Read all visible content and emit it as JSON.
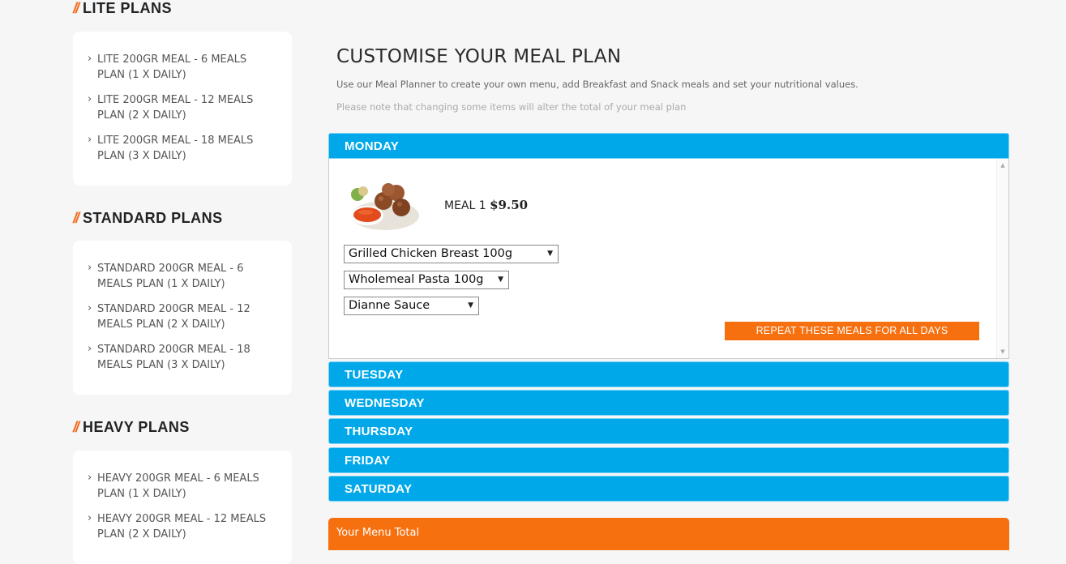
{
  "sidebar": {
    "sections": [
      {
        "slashes": "//",
        "title": "LITE PLANS",
        "items": [
          "LITE 200GR MEAL - 6 MEALS PLAN (1 X DAILY)",
          "LITE 200GR MEAL - 12 MEALS PLAN (2 X DAILY)",
          "LITE 200GR MEAL - 18 MEALS PLAN (3 X DAILY)"
        ]
      },
      {
        "slashes": "//",
        "title": "STANDARD PLANS",
        "items": [
          "STANDARD 200GR MEAL - 6 MEALS PLAN (1 X DAILY)",
          "STANDARD 200GR MEAL - 12 MEALS PLAN (2 X DAILY)",
          "STANDARD 200GR MEAL - 18 MEALS PLAN (3 X DAILY)"
        ]
      },
      {
        "slashes": "//",
        "title": "HEAVY PLANS",
        "items": [
          "HEAVY 200GR MEAL - 6 MEALS PLAN (1 X DAILY)",
          "HEAVY 200GR MEAL - 12 MEALS PLAN (2 X DAILY)"
        ]
      }
    ],
    "chevron": "›"
  },
  "main": {
    "title": "CUSTOMISE YOUR MEAL PLAN",
    "description": "Use our Meal Planner to create your own menu, add Breakfast and Snack meals and set your nutritional values.",
    "note": "Please note that changing some items will alter the total of your meal plan",
    "days": [
      "MONDAY",
      "TUESDAY",
      "WEDNESDAY",
      "THURSDAY",
      "FRIDAY",
      "SATURDAY"
    ],
    "meal": {
      "label": "MEAL 1",
      "price": "$9.50",
      "selects": [
        {
          "value": "Grilled Chicken Breast 100g"
        },
        {
          "value": "Wholemeal Pasta 100g"
        },
        {
          "value": "Dianne Sauce"
        }
      ],
      "repeat_label": "REPEAT THESE MEALS FOR ALL DAYS"
    },
    "total_label": "Your Menu Total"
  },
  "colors": {
    "accent_blue": "#00a8ea",
    "accent_orange": "#f7700f",
    "slash_orange": "#f26a1b"
  },
  "icons": {
    "select_arrow": "▼",
    "scroll_up": "▲",
    "scroll_down": "▼"
  }
}
